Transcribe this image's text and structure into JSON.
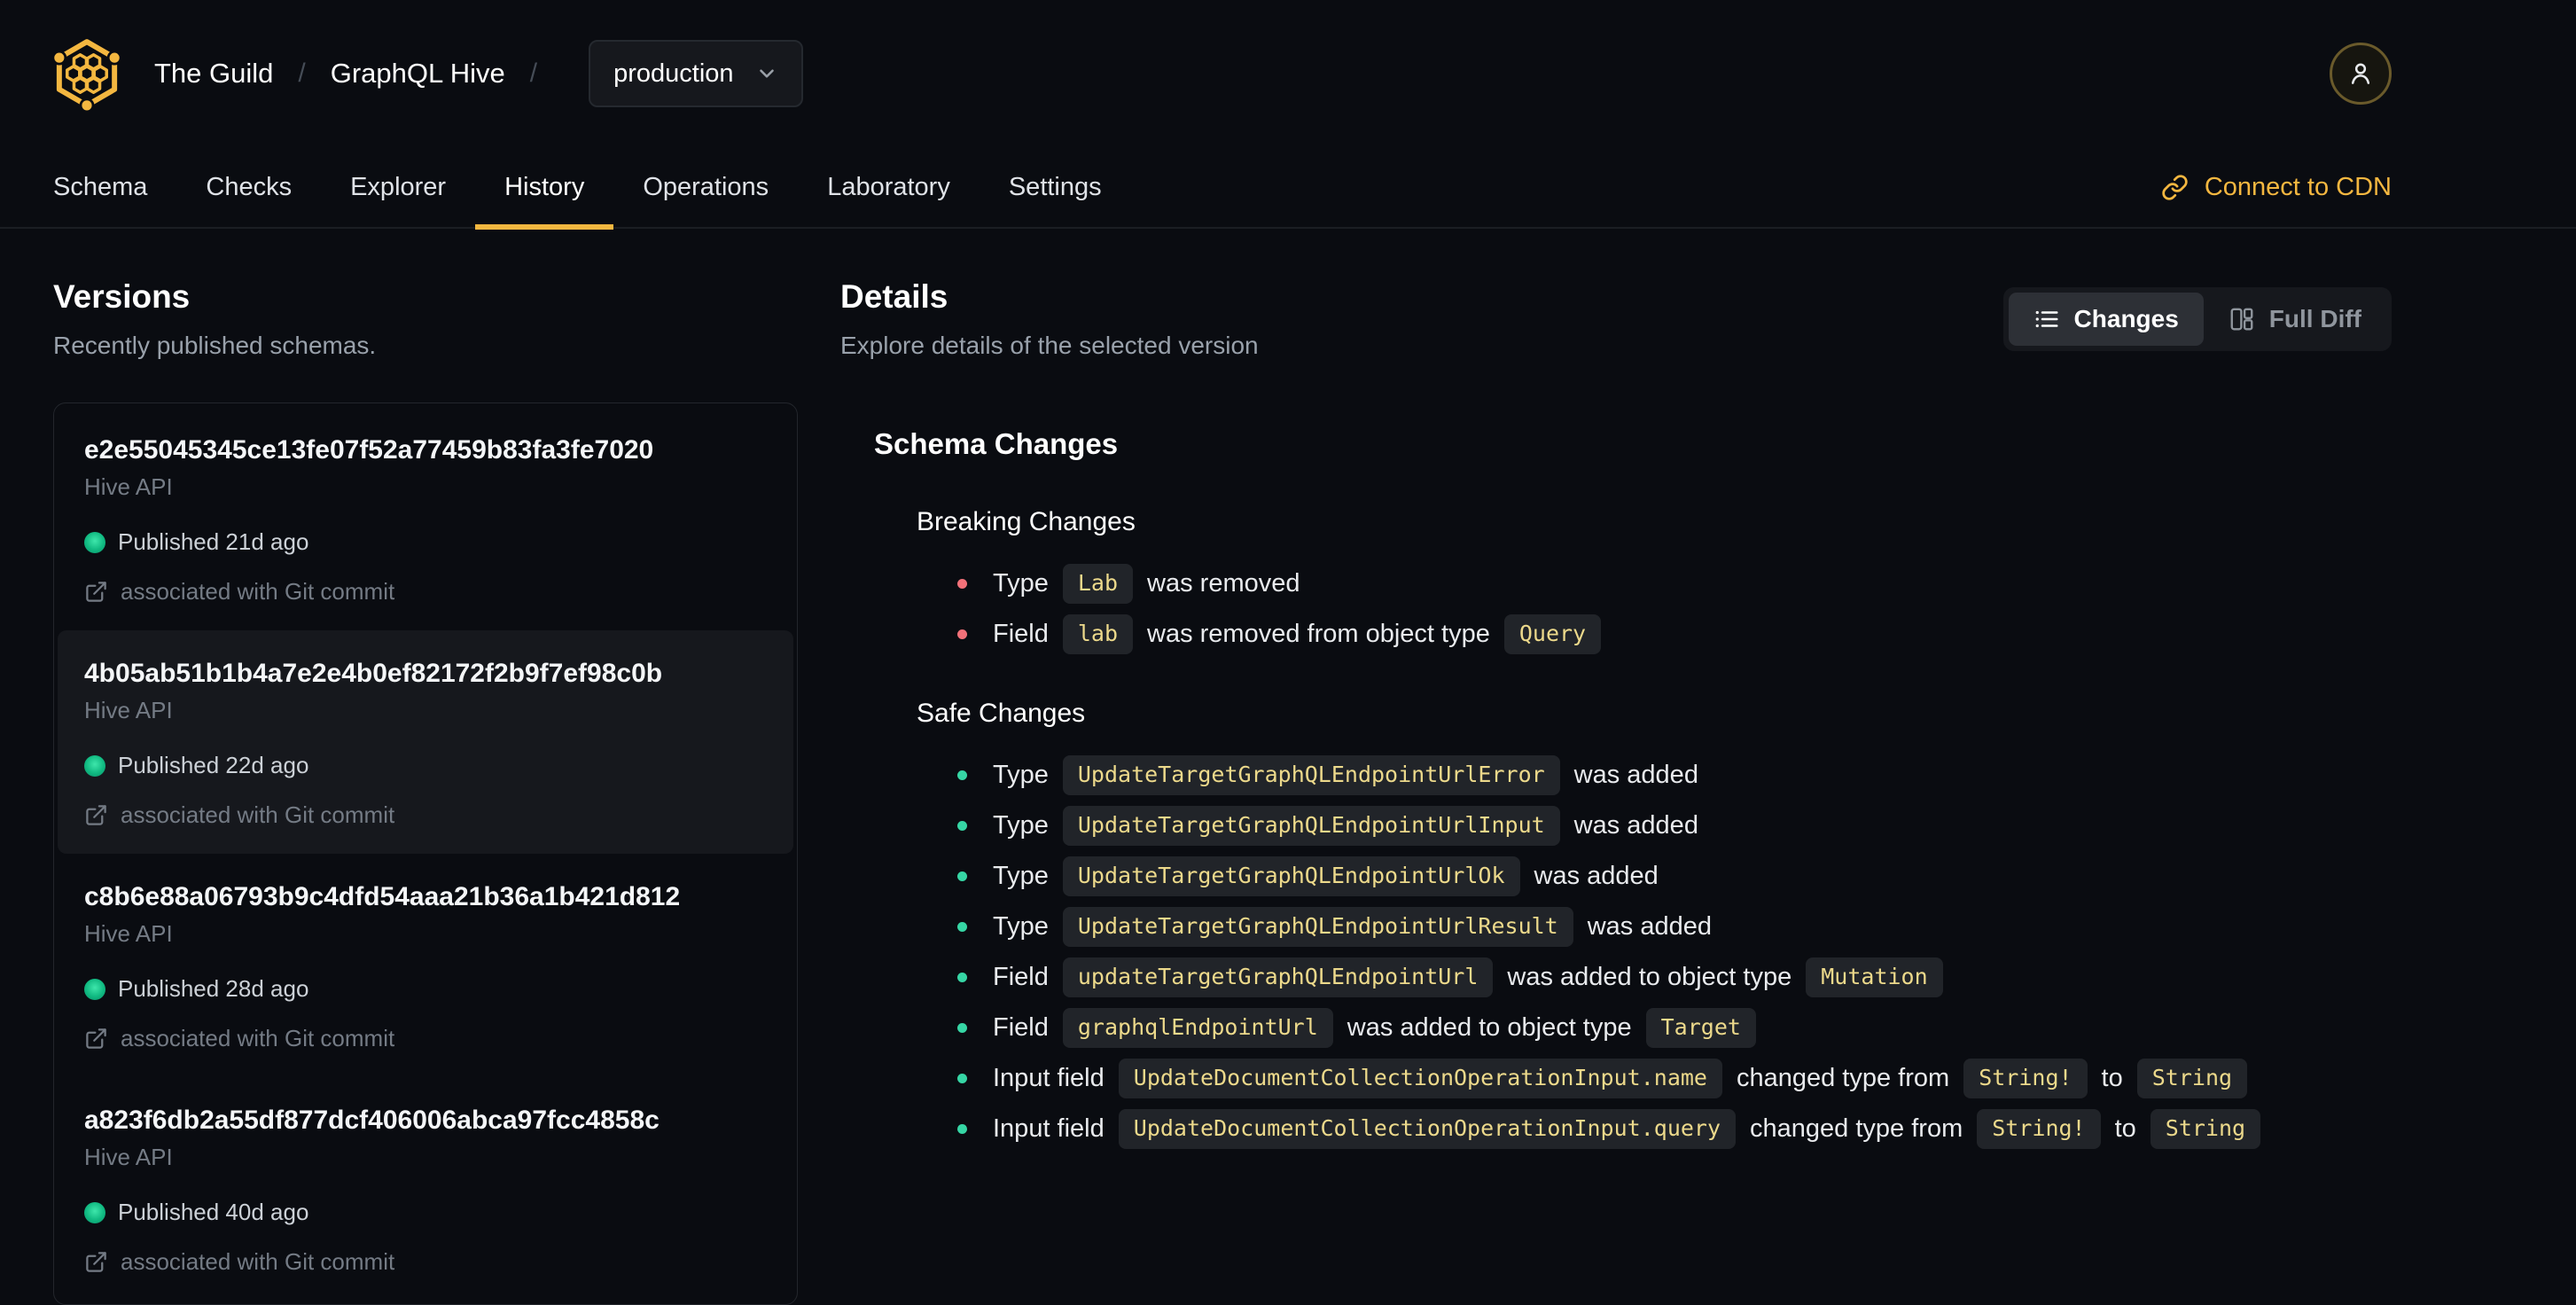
{
  "colors": {
    "accent": "#f4b740",
    "page_bg": "#0a0c11",
    "code_text": "#ecd98b",
    "code_bg": "#212429",
    "published_dot": "#10b981",
    "selected_item_bg": "#16181d",
    "breaking_bullet": "#f27179",
    "safe_bullet": "#36d6a5"
  },
  "header": {
    "breadcrumb": {
      "org": "The Guild",
      "project": "GraphQL Hive",
      "separator": "/"
    },
    "target_select": {
      "value": "production"
    },
    "nav": {
      "tabs": [
        {
          "label": "Schema",
          "active": false
        },
        {
          "label": "Checks",
          "active": false
        },
        {
          "label": "Explorer",
          "active": false
        },
        {
          "label": "History",
          "active": true
        },
        {
          "label": "Operations",
          "active": false
        },
        {
          "label": "Laboratory",
          "active": false
        },
        {
          "label": "Settings",
          "active": false
        }
      ]
    },
    "cdn_link": "Connect to CDN"
  },
  "versions_panel": {
    "title": "Versions",
    "subtitle": "Recently published schemas.",
    "items": [
      {
        "hash": "e2e55045345ce13fe07f52a77459b83fa3fe7020",
        "service": "Hive API",
        "published": "Published 21d ago",
        "git": "associated with Git commit",
        "selected": false
      },
      {
        "hash": "4b05ab51b1b4a7e2e4b0ef82172f2b9f7ef98c0b",
        "service": "Hive API",
        "published": "Published 22d ago",
        "git": "associated with Git commit",
        "selected": true
      },
      {
        "hash": "c8b6e88a06793b9c4dfd54aaa21b36a1b421d812",
        "service": "Hive API",
        "published": "Published 28d ago",
        "git": "associated with Git commit",
        "selected": false
      },
      {
        "hash": "a823f6db2a55df877dcf406006abca97fcc4858c",
        "service": "Hive API",
        "published": "Published 40d ago",
        "git": "associated with Git commit",
        "selected": false
      }
    ]
  },
  "details_panel": {
    "title": "Details",
    "subtitle": "Explore details of the selected version",
    "view_toggle": {
      "changes": "Changes",
      "full_diff": "Full Diff",
      "active": "changes"
    },
    "schema_changes": {
      "title": "Schema Changes",
      "sections": [
        {
          "name": "Breaking Changes",
          "bullet_color": "#f27179",
          "items": [
            [
              {
                "t": "text",
                "v": "Type"
              },
              {
                "t": "code",
                "v": "Lab"
              },
              {
                "t": "text",
                "v": "was removed"
              }
            ],
            [
              {
                "t": "text",
                "v": "Field"
              },
              {
                "t": "code",
                "v": "lab"
              },
              {
                "t": "text",
                "v": "was removed from object type"
              },
              {
                "t": "code",
                "v": "Query"
              }
            ]
          ]
        },
        {
          "name": "Safe Changes",
          "bullet_color": "#36d6a5",
          "items": [
            [
              {
                "t": "text",
                "v": "Type"
              },
              {
                "t": "code",
                "v": "UpdateTargetGraphQLEndpointUrlError"
              },
              {
                "t": "text",
                "v": "was added"
              }
            ],
            [
              {
                "t": "text",
                "v": "Type"
              },
              {
                "t": "code",
                "v": "UpdateTargetGraphQLEndpointUrlInput"
              },
              {
                "t": "text",
                "v": "was added"
              }
            ],
            [
              {
                "t": "text",
                "v": "Type"
              },
              {
                "t": "code",
                "v": "UpdateTargetGraphQLEndpointUrlOk"
              },
              {
                "t": "text",
                "v": "was added"
              }
            ],
            [
              {
                "t": "text",
                "v": "Type"
              },
              {
                "t": "code",
                "v": "UpdateTargetGraphQLEndpointUrlResult"
              },
              {
                "t": "text",
                "v": "was added"
              }
            ],
            [
              {
                "t": "text",
                "v": "Field"
              },
              {
                "t": "code",
                "v": "updateTargetGraphQLEndpointUrl"
              },
              {
                "t": "text",
                "v": "was added to object type"
              },
              {
                "t": "code",
                "v": "Mutation"
              }
            ],
            [
              {
                "t": "text",
                "v": "Field"
              },
              {
                "t": "code",
                "v": "graphqlEndpointUrl"
              },
              {
                "t": "text",
                "v": "was added to object type"
              },
              {
                "t": "code",
                "v": "Target"
              }
            ],
            [
              {
                "t": "text",
                "v": "Input field"
              },
              {
                "t": "code",
                "v": "UpdateDocumentCollectionOperationInput.name"
              },
              {
                "t": "text",
                "v": "changed type from"
              },
              {
                "t": "code",
                "v": "String!"
              },
              {
                "t": "text",
                "v": "to"
              },
              {
                "t": "code",
                "v": "String"
              }
            ],
            [
              {
                "t": "text",
                "v": "Input field"
              },
              {
                "t": "code",
                "v": "UpdateDocumentCollectionOperationInput.query"
              },
              {
                "t": "text",
                "v": "changed type from"
              },
              {
                "t": "code",
                "v": "String!"
              },
              {
                "t": "text",
                "v": "to"
              },
              {
                "t": "code",
                "v": "String"
              }
            ]
          ]
        }
      ]
    }
  }
}
